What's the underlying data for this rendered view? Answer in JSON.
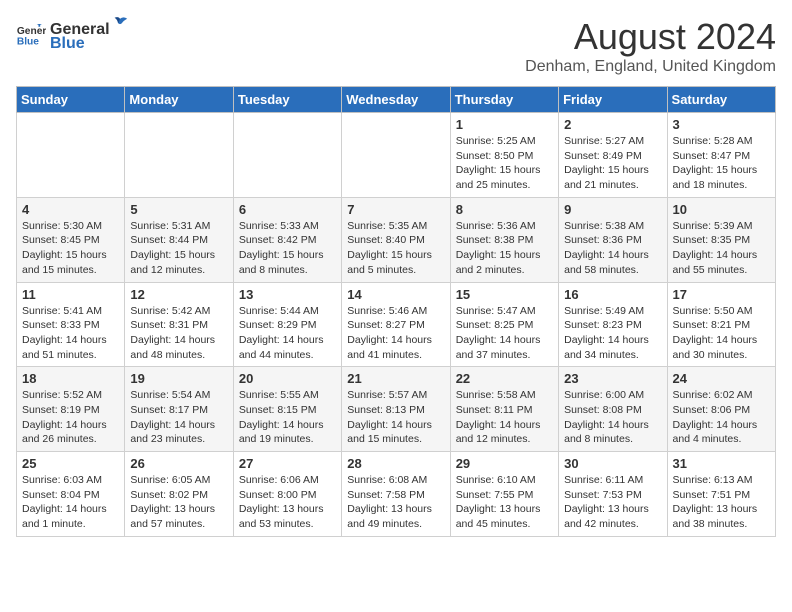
{
  "header": {
    "logo_general": "General",
    "logo_blue": "Blue",
    "month_title": "August 2024",
    "location": "Denham, England, United Kingdom"
  },
  "days_of_week": [
    "Sunday",
    "Monday",
    "Tuesday",
    "Wednesday",
    "Thursday",
    "Friday",
    "Saturday"
  ],
  "weeks": [
    [
      {
        "day": "",
        "text": ""
      },
      {
        "day": "",
        "text": ""
      },
      {
        "day": "",
        "text": ""
      },
      {
        "day": "",
        "text": ""
      },
      {
        "day": "1",
        "text": "Sunrise: 5:25 AM\nSunset: 8:50 PM\nDaylight: 15 hours\nand 25 minutes."
      },
      {
        "day": "2",
        "text": "Sunrise: 5:27 AM\nSunset: 8:49 PM\nDaylight: 15 hours\nand 21 minutes."
      },
      {
        "day": "3",
        "text": "Sunrise: 5:28 AM\nSunset: 8:47 PM\nDaylight: 15 hours\nand 18 minutes."
      }
    ],
    [
      {
        "day": "4",
        "text": "Sunrise: 5:30 AM\nSunset: 8:45 PM\nDaylight: 15 hours\nand 15 minutes."
      },
      {
        "day": "5",
        "text": "Sunrise: 5:31 AM\nSunset: 8:44 PM\nDaylight: 15 hours\nand 12 minutes."
      },
      {
        "day": "6",
        "text": "Sunrise: 5:33 AM\nSunset: 8:42 PM\nDaylight: 15 hours\nand 8 minutes."
      },
      {
        "day": "7",
        "text": "Sunrise: 5:35 AM\nSunset: 8:40 PM\nDaylight: 15 hours\nand 5 minutes."
      },
      {
        "day": "8",
        "text": "Sunrise: 5:36 AM\nSunset: 8:38 PM\nDaylight: 15 hours\nand 2 minutes."
      },
      {
        "day": "9",
        "text": "Sunrise: 5:38 AM\nSunset: 8:36 PM\nDaylight: 14 hours\nand 58 minutes."
      },
      {
        "day": "10",
        "text": "Sunrise: 5:39 AM\nSunset: 8:35 PM\nDaylight: 14 hours\nand 55 minutes."
      }
    ],
    [
      {
        "day": "11",
        "text": "Sunrise: 5:41 AM\nSunset: 8:33 PM\nDaylight: 14 hours\nand 51 minutes."
      },
      {
        "day": "12",
        "text": "Sunrise: 5:42 AM\nSunset: 8:31 PM\nDaylight: 14 hours\nand 48 minutes."
      },
      {
        "day": "13",
        "text": "Sunrise: 5:44 AM\nSunset: 8:29 PM\nDaylight: 14 hours\nand 44 minutes."
      },
      {
        "day": "14",
        "text": "Sunrise: 5:46 AM\nSunset: 8:27 PM\nDaylight: 14 hours\nand 41 minutes."
      },
      {
        "day": "15",
        "text": "Sunrise: 5:47 AM\nSunset: 8:25 PM\nDaylight: 14 hours\nand 37 minutes."
      },
      {
        "day": "16",
        "text": "Sunrise: 5:49 AM\nSunset: 8:23 PM\nDaylight: 14 hours\nand 34 minutes."
      },
      {
        "day": "17",
        "text": "Sunrise: 5:50 AM\nSunset: 8:21 PM\nDaylight: 14 hours\nand 30 minutes."
      }
    ],
    [
      {
        "day": "18",
        "text": "Sunrise: 5:52 AM\nSunset: 8:19 PM\nDaylight: 14 hours\nand 26 minutes."
      },
      {
        "day": "19",
        "text": "Sunrise: 5:54 AM\nSunset: 8:17 PM\nDaylight: 14 hours\nand 23 minutes."
      },
      {
        "day": "20",
        "text": "Sunrise: 5:55 AM\nSunset: 8:15 PM\nDaylight: 14 hours\nand 19 minutes."
      },
      {
        "day": "21",
        "text": "Sunrise: 5:57 AM\nSunset: 8:13 PM\nDaylight: 14 hours\nand 15 minutes."
      },
      {
        "day": "22",
        "text": "Sunrise: 5:58 AM\nSunset: 8:11 PM\nDaylight: 14 hours\nand 12 minutes."
      },
      {
        "day": "23",
        "text": "Sunrise: 6:00 AM\nSunset: 8:08 PM\nDaylight: 14 hours\nand 8 minutes."
      },
      {
        "day": "24",
        "text": "Sunrise: 6:02 AM\nSunset: 8:06 PM\nDaylight: 14 hours\nand 4 minutes."
      }
    ],
    [
      {
        "day": "25",
        "text": "Sunrise: 6:03 AM\nSunset: 8:04 PM\nDaylight: 14 hours\nand 1 minute."
      },
      {
        "day": "26",
        "text": "Sunrise: 6:05 AM\nSunset: 8:02 PM\nDaylight: 13 hours\nand 57 minutes."
      },
      {
        "day": "27",
        "text": "Sunrise: 6:06 AM\nSunset: 8:00 PM\nDaylight: 13 hours\nand 53 minutes."
      },
      {
        "day": "28",
        "text": "Sunrise: 6:08 AM\nSunset: 7:58 PM\nDaylight: 13 hours\nand 49 minutes."
      },
      {
        "day": "29",
        "text": "Sunrise: 6:10 AM\nSunset: 7:55 PM\nDaylight: 13 hours\nand 45 minutes."
      },
      {
        "day": "30",
        "text": "Sunrise: 6:11 AM\nSunset: 7:53 PM\nDaylight: 13 hours\nand 42 minutes."
      },
      {
        "day": "31",
        "text": "Sunrise: 6:13 AM\nSunset: 7:51 PM\nDaylight: 13 hours\nand 38 minutes."
      }
    ]
  ]
}
